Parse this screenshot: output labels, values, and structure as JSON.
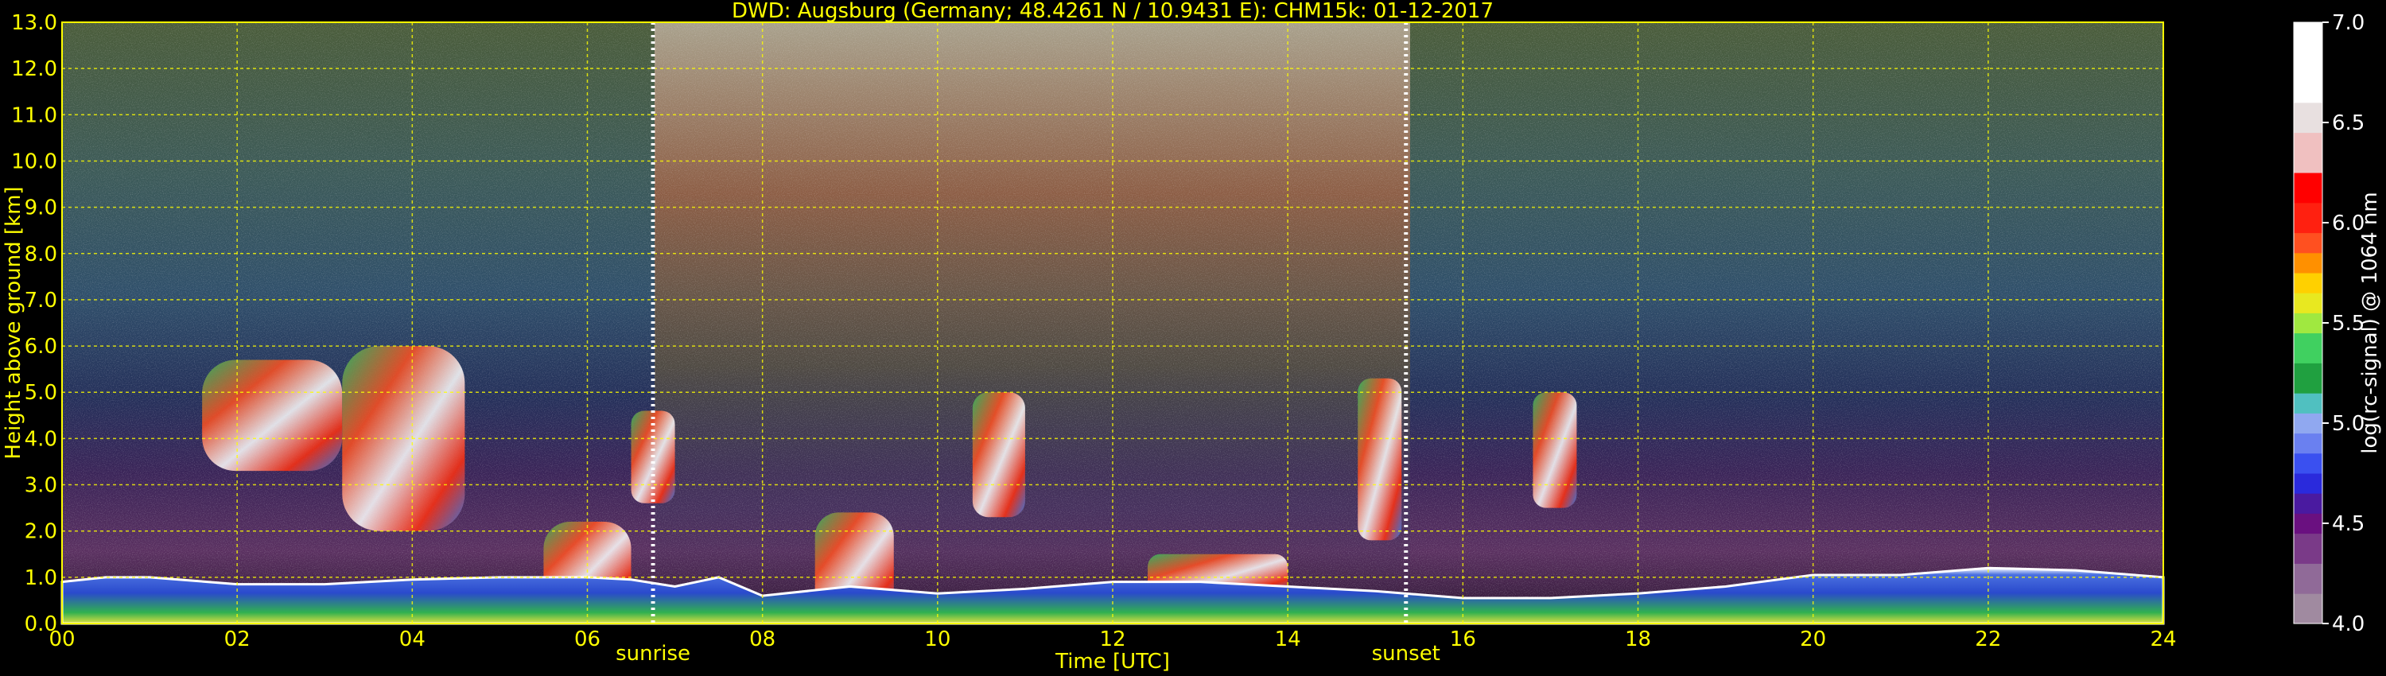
{
  "chart_data": {
    "type": "heatmap",
    "title": "DWD: Augsburg (Germany; 48.4261 N / 10.9431 E):    CHM15k: 01-12-2017",
    "xlabel": "Time [UTC]",
    "ylabel": "Height above ground [km]",
    "xlim": [
      0,
      24
    ],
    "ylim": [
      0,
      13
    ],
    "xticks": [
      "00",
      "02",
      "04",
      "06",
      "08",
      "10",
      "12",
      "14",
      "16",
      "18",
      "20",
      "22",
      "24"
    ],
    "yticks": [
      "0.0",
      "1.0",
      "2.0",
      "3.0",
      "4.0",
      "5.0",
      "6.0",
      "7.0",
      "8.0",
      "9.0",
      "10.0",
      "11.0",
      "12.0",
      "13.0"
    ],
    "grid": true,
    "markers": [
      {
        "label": "sunrise",
        "time": 6.75
      },
      {
        "label": "sunset",
        "time": 15.35
      }
    ],
    "colorbar": {
      "label": "log(rc-signal) @ 1064 nm",
      "range": [
        4.0,
        7.0
      ],
      "ticks": [
        "4.0",
        "4.5",
        "5.0",
        "5.5",
        "6.0",
        "6.5",
        "7.0"
      ]
    },
    "boundary_layer_top_km": [
      [
        0,
        0.9
      ],
      [
        0.5,
        1.0
      ],
      [
        1,
        1.0
      ],
      [
        2,
        0.85
      ],
      [
        3,
        0.85
      ],
      [
        4,
        0.95
      ],
      [
        5,
        1.0
      ],
      [
        6,
        1.0
      ],
      [
        6.5,
        0.95
      ],
      [
        7,
        0.8
      ],
      [
        7.5,
        1.0
      ],
      [
        8,
        0.6
      ],
      [
        9,
        0.8
      ],
      [
        10,
        0.65
      ],
      [
        11,
        0.75
      ],
      [
        12,
        0.9
      ],
      [
        13,
        0.9
      ],
      [
        14,
        0.8
      ],
      [
        15,
        0.7
      ],
      [
        16,
        0.55
      ],
      [
        17,
        0.55
      ],
      [
        18,
        0.65
      ],
      [
        19,
        0.8
      ],
      [
        20,
        1.05
      ],
      [
        21,
        1.05
      ],
      [
        22,
        1.2
      ],
      [
        23,
        1.15
      ],
      [
        24,
        1.0
      ]
    ],
    "cloud_layers": [
      {
        "start": 1.6,
        "end": 3.2,
        "base_km": 3.3,
        "top_km": 5.7
      },
      {
        "start": 3.2,
        "end": 4.6,
        "base_km": 2.0,
        "top_km": 6.0
      },
      {
        "start": 5.5,
        "end": 6.5,
        "base_km": 0.3,
        "top_km": 2.2
      },
      {
        "start": 6.5,
        "end": 7.0,
        "base_km": 2.6,
        "top_km": 4.6
      },
      {
        "start": 8.6,
        "end": 9.5,
        "base_km": 0.1,
        "top_km": 2.4
      },
      {
        "start": 10.4,
        "end": 11.0,
        "base_km": 2.3,
        "top_km": 5.0
      },
      {
        "start": 12.4,
        "end": 14.0,
        "base_km": 0.6,
        "top_km": 1.5
      },
      {
        "start": 14.8,
        "end": 15.3,
        "base_km": 1.8,
        "top_km": 5.3
      },
      {
        "start": 16.8,
        "end": 17.3,
        "base_km": 2.5,
        "top_km": 5.0
      }
    ]
  }
}
